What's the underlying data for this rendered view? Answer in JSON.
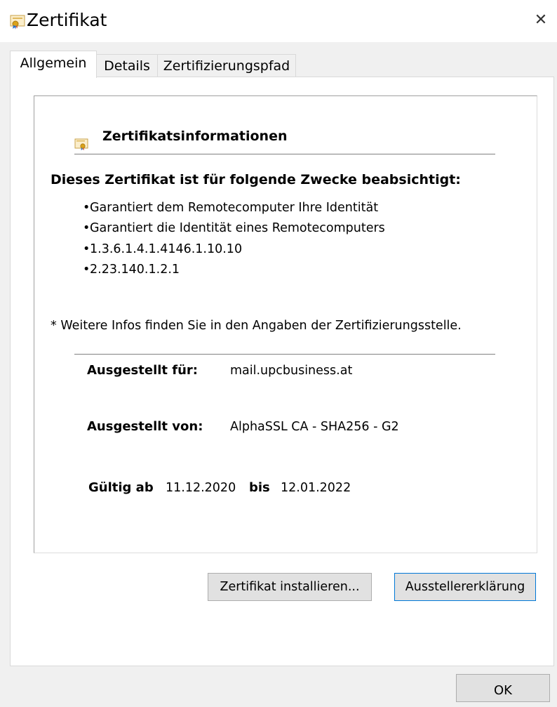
{
  "window": {
    "title": "Zertifikat",
    "close_glyph": "✕",
    "icon": "certificate-icon"
  },
  "tabs": [
    {
      "label": "Allgemein",
      "active": true
    },
    {
      "label": "Details",
      "active": false
    },
    {
      "label": "Zertifizierungspfad",
      "active": false
    }
  ],
  "general": {
    "section_title": "Zertifikatsinformationen",
    "section_icon": "certificate-icon",
    "purpose_heading": "Dieses Zertifikat ist für folgende Zwecke beabsichtigt:",
    "purposes": [
      "Garantiert dem Remotecomputer Ihre Identität",
      "Garantiert die Identität eines Remotecomputers",
      "1.3.6.1.4.1.4146.1.10.10",
      "2.23.140.1.2.1"
    ],
    "footnote": "* Weitere Infos finden Sie in den Angaben der Zertifizierungsstelle.",
    "issued_to_label": "Ausgestellt für:",
    "issued_to_value": "mail.upcbusiness.at",
    "issued_by_label": "Ausgestellt von:",
    "issued_by_value": "AlphaSSL CA - SHA256 - G2",
    "valid_from_label": "Gültig ab",
    "valid_from_value": "11.12.2020",
    "valid_to_label": "bis",
    "valid_to_value": "12.01.2022"
  },
  "buttons": {
    "install": "Zertifikat installieren...",
    "issuer_statement": "Ausstellererklärung",
    "ok": "OK"
  },
  "colors": {
    "window_bg": "#f0f0f0",
    "panel_bg": "#ffffff",
    "button_bg": "#e1e1e1",
    "focus_border": "#0078d7"
  }
}
